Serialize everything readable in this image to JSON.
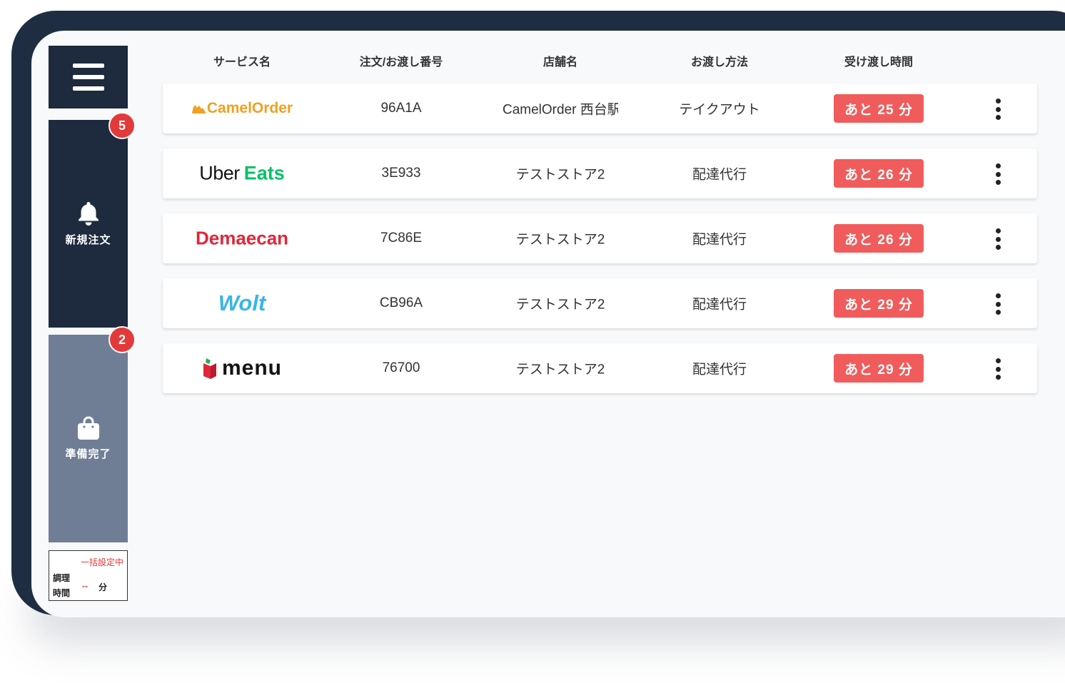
{
  "sidebar": {
    "new_orders": {
      "label": "新規注文",
      "badge": "5",
      "icon": "bell-icon"
    },
    "ready": {
      "label": "準備完了",
      "badge": "2",
      "icon": "shopping-bag-icon"
    },
    "cook_time": {
      "mode": "一括設定中",
      "label_line1": "調理",
      "label_line2": "時間",
      "value": "--",
      "unit": "分"
    }
  },
  "table": {
    "headers": [
      "サービス名",
      "注文/お渡し番号",
      "店舗名",
      "お渡し方法",
      "受け渡し時間"
    ],
    "rows": [
      {
        "service": "CamelOrder",
        "logo_parts": [
          "Camel",
          "Order"
        ],
        "number": "96A1A",
        "store": "CamelOrder 西台駅",
        "method": "テイクアウト",
        "time": "あと 25 分"
      },
      {
        "service": "Uber Eats",
        "logo_parts": [
          "Uber",
          "Eats"
        ],
        "number": "3E933",
        "store": "テストストア2",
        "method": "配達代行",
        "time": "あと 26 分"
      },
      {
        "service": "Demaecan",
        "logo_parts": [
          "Demaecan"
        ],
        "number": "7C86E",
        "store": "テストストア2",
        "method": "配達代行",
        "time": "あと 26 分"
      },
      {
        "service": "Wolt",
        "logo_parts": [
          "Wolt"
        ],
        "number": "CB96A",
        "store": "テストストア2",
        "method": "配達代行",
        "time": "あと 29 分"
      },
      {
        "service": "menu",
        "logo_parts": [
          "menu"
        ],
        "number": "76700",
        "store": "テストストア2",
        "method": "配達代行",
        "time": "あと 29 分"
      }
    ]
  },
  "colors": {
    "frame": "#1f2d43",
    "nav_active": "#1e2a3d",
    "nav_inactive": "#707e95",
    "badge": "#e23a3a",
    "time_badge": "#f05c5c",
    "camel": "#f0a020",
    "uber_eats_green": "#06c167",
    "demaecan_red": "#e0263b",
    "wolt_blue": "#3ab5e6"
  }
}
